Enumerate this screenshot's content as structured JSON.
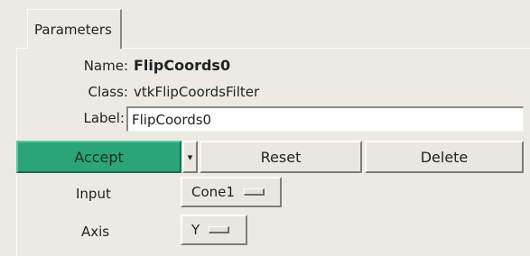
{
  "tabs": [
    {
      "label": "Parameters"
    }
  ],
  "fields": {
    "name_label": "Name:",
    "name_value": "FlipCoords0",
    "class_label": "Class:",
    "class_value": "vtkFlipCoordsFilter",
    "label_label": "Label:",
    "label_value": "FlipCoords0"
  },
  "buttons": {
    "accept": "Accept",
    "arrow": "▾",
    "reset": "Reset",
    "delete": "Delete"
  },
  "params": {
    "input_label": "Input",
    "input_value": "Cone1",
    "axis_label": "Axis",
    "axis_value": "Y"
  },
  "colors": {
    "accept_bg": "#2ba47a",
    "panel_bg": "#ecebe3"
  }
}
